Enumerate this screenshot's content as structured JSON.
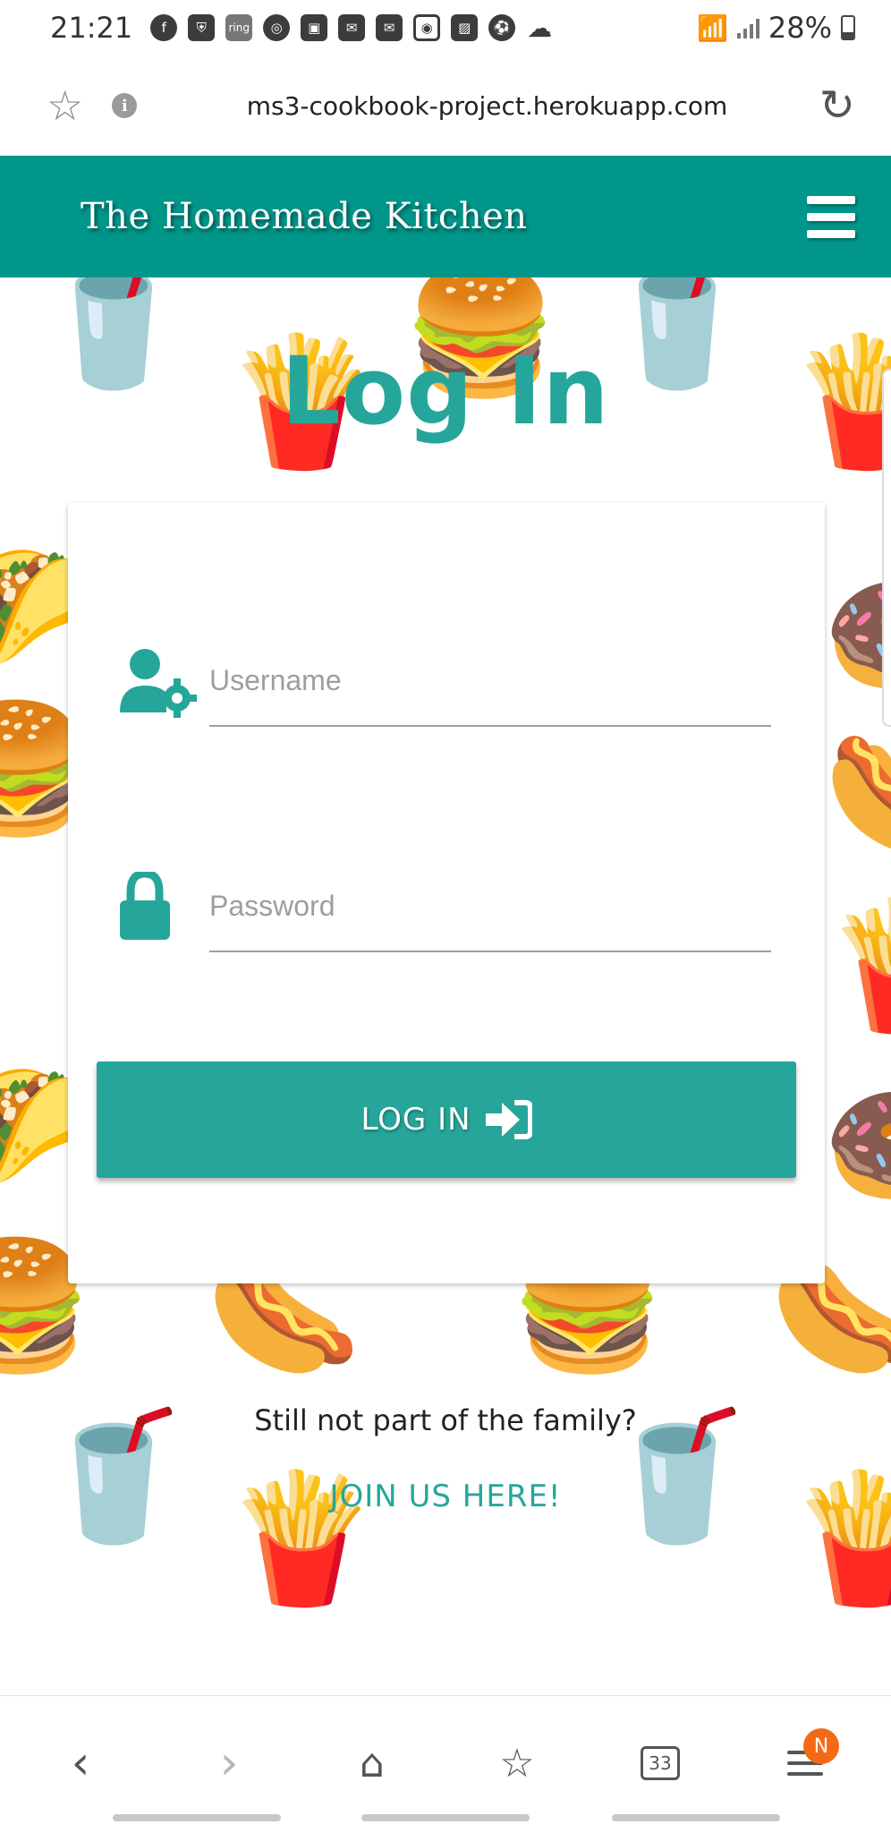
{
  "status_bar": {
    "time": "21:21",
    "notification_icons": [
      "facebook-icon",
      "shield-icon",
      "ring-icon",
      "chrome-icon",
      "twitch-icon",
      "mail-icon",
      "gmail-icon",
      "instagram-icon",
      "gallery-icon",
      "soccer-icon",
      "cloud-icon"
    ],
    "ring_label": "ring",
    "battery": "28%"
  },
  "browser": {
    "url": "ms3-cookbook-project.herokuapp.com",
    "tab_count": "33",
    "menu_badge": "N"
  },
  "navbar": {
    "brand": "The Homemade Kitchen"
  },
  "page": {
    "title": "Log In",
    "username_placeholder": "Username",
    "password_placeholder": "Password",
    "login_button": "LOG IN",
    "family_text": "Still not part of the family?",
    "join_link": "JOIN US HERE!"
  },
  "colors": {
    "brand_teal": "#00968a",
    "accent_teal": "#26a69a",
    "badge_orange": "#f46a14"
  }
}
